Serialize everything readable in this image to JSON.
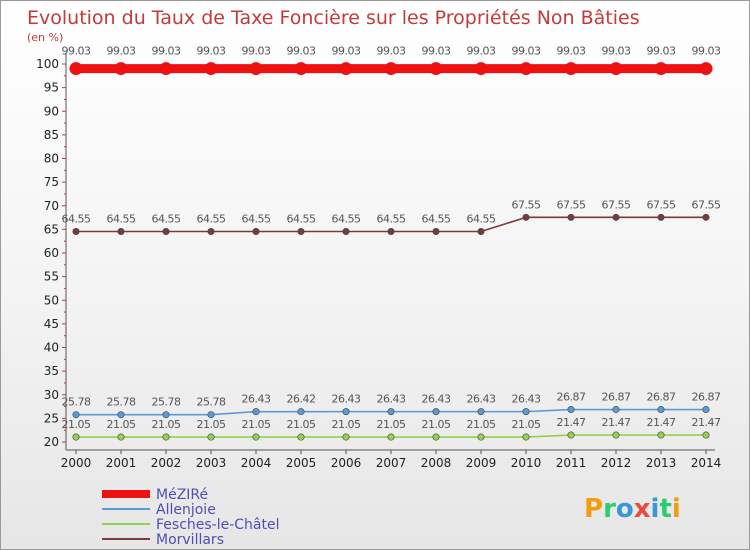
{
  "chart_data": {
    "type": "line",
    "title": "Evolution du Taux de Taxe Foncière sur les Propriétés Non Bâties",
    "ylabel": "(en %)",
    "xlabel": "",
    "ylim": [
      20,
      100
    ],
    "yticks": [
      20,
      25,
      30,
      35,
      40,
      45,
      50,
      55,
      60,
      65,
      70,
      75,
      80,
      85,
      90,
      95,
      100
    ],
    "x": [
      "2000",
      "2001",
      "2002",
      "2003",
      "2004",
      "2005",
      "2006",
      "2007",
      "2008",
      "2009",
      "2010",
      "2011",
      "2012",
      "2013",
      "2014"
    ],
    "grid": false,
    "legend_position": "bottom-left",
    "series": [
      {
        "name": "MéZIRé",
        "color": "#ee1111",
        "emphasized": true,
        "values": [
          99.03,
          99.03,
          99.03,
          99.03,
          99.03,
          99.03,
          99.03,
          99.03,
          99.03,
          99.03,
          99.03,
          99.03,
          99.03,
          99.03,
          99.03
        ],
        "labels": [
          "99.03",
          "99.03",
          "99.03",
          "99.03",
          "99.03",
          "99.03",
          "99.03",
          "99.03",
          "99.03",
          "99.03",
          "99.03",
          "99.03",
          "99.03",
          "99.03",
          "99.03"
        ]
      },
      {
        "name": "Allenjoie",
        "color": "#5b9bd5",
        "emphasized": false,
        "values": [
          25.78,
          25.78,
          25.78,
          25.78,
          26.43,
          26.42,
          26.43,
          26.43,
          26.43,
          26.43,
          26.43,
          26.87,
          26.87,
          26.87,
          26.87
        ],
        "labels": [
          "25.78",
          "25.78",
          "25.78",
          "25.78",
          "26.43",
          "26.42",
          "26.43",
          "26.43",
          "26.43",
          "26.43",
          "26.43",
          "26.87",
          "26.87",
          "26.87",
          "26.87"
        ]
      },
      {
        "name": "Fesches-le-Châtel",
        "color": "#92d050",
        "emphasized": false,
        "values": [
          21.05,
          21.05,
          21.05,
          21.05,
          21.05,
          21.05,
          21.05,
          21.05,
          21.05,
          21.05,
          21.05,
          21.47,
          21.47,
          21.47,
          21.47
        ],
        "labels": [
          "21.05",
          "21.05",
          "21.05",
          "21.05",
          "21.05",
          "21.05",
          "21.05",
          "21.05",
          "21.05",
          "21.05",
          "21.05",
          "21.47",
          "21.47",
          "21.47",
          "21.47"
        ]
      },
      {
        "name": "Morvillars",
        "color": "#7a3a3a",
        "emphasized": false,
        "values": [
          64.55,
          64.55,
          64.55,
          64.55,
          64.55,
          64.55,
          64.55,
          64.55,
          64.55,
          64.55,
          67.55,
          67.55,
          67.55,
          67.55,
          67.55
        ],
        "labels": [
          "64.55",
          "64.55",
          "64.55",
          "64.55",
          "64.55",
          "64.55",
          "64.55",
          "64.55",
          "64.55",
          "64.55",
          "67.55",
          "67.55",
          "67.55",
          "67.55",
          "67.55"
        ]
      }
    ]
  },
  "logo": {
    "text": "Proxiti",
    "colors": [
      "#f39c12",
      "#2ecc71",
      "#3498db",
      "#e74c3c",
      "#3498db",
      "#2ecc71",
      "#f39c12"
    ]
  }
}
